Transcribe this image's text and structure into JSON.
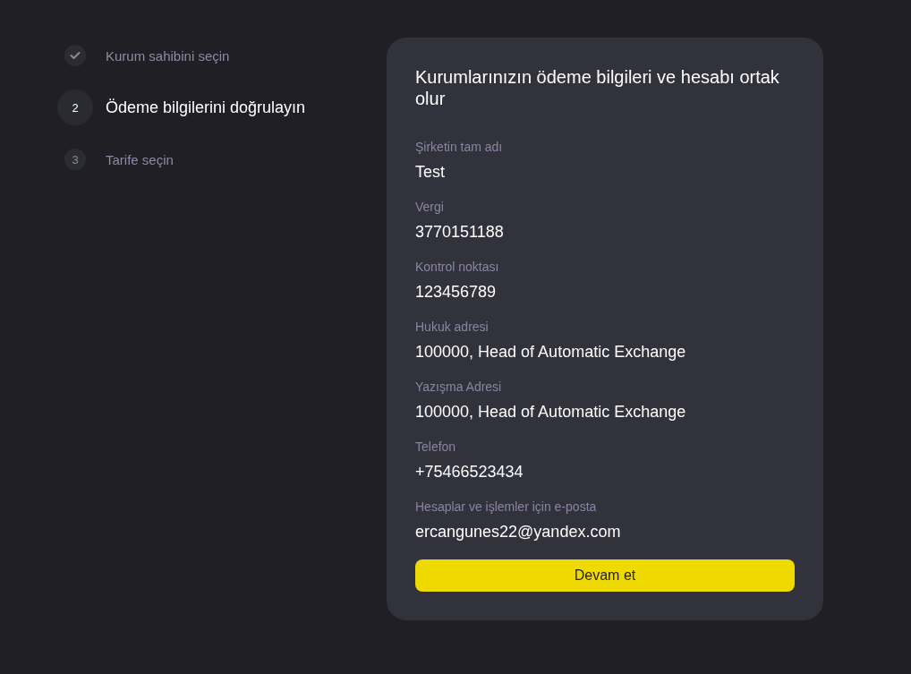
{
  "steps": [
    {
      "kind": "done",
      "label": "Kurum sahibini seçin"
    },
    {
      "kind": "current",
      "number": "2",
      "label": "Ödeme bilgilerini doğrulayın"
    },
    {
      "kind": "pending",
      "number": "3",
      "label": "Tarife seçin"
    }
  ],
  "card": {
    "title": "Kurumlarınızın ödeme bilgileri ve hesabı ortak olur",
    "fields": [
      {
        "label": "Şirketin tam adı",
        "value": "Test"
      },
      {
        "label": "Vergi",
        "value": "3770151188"
      },
      {
        "label": "Kontrol noktası",
        "value": "123456789"
      },
      {
        "label": "Hukuk adresi",
        "value": "100000, Head of Automatic Exchange"
      },
      {
        "label": "Yazışma Adresi",
        "value": "100000, Head of Automatic Exchange"
      },
      {
        "label": "Telefon",
        "value": "+75466523434"
      },
      {
        "label": "Hesaplar ve işlemler için e-posta",
        "value": "ercangunes22@yandex.com"
      }
    ],
    "button": "Devam et"
  }
}
